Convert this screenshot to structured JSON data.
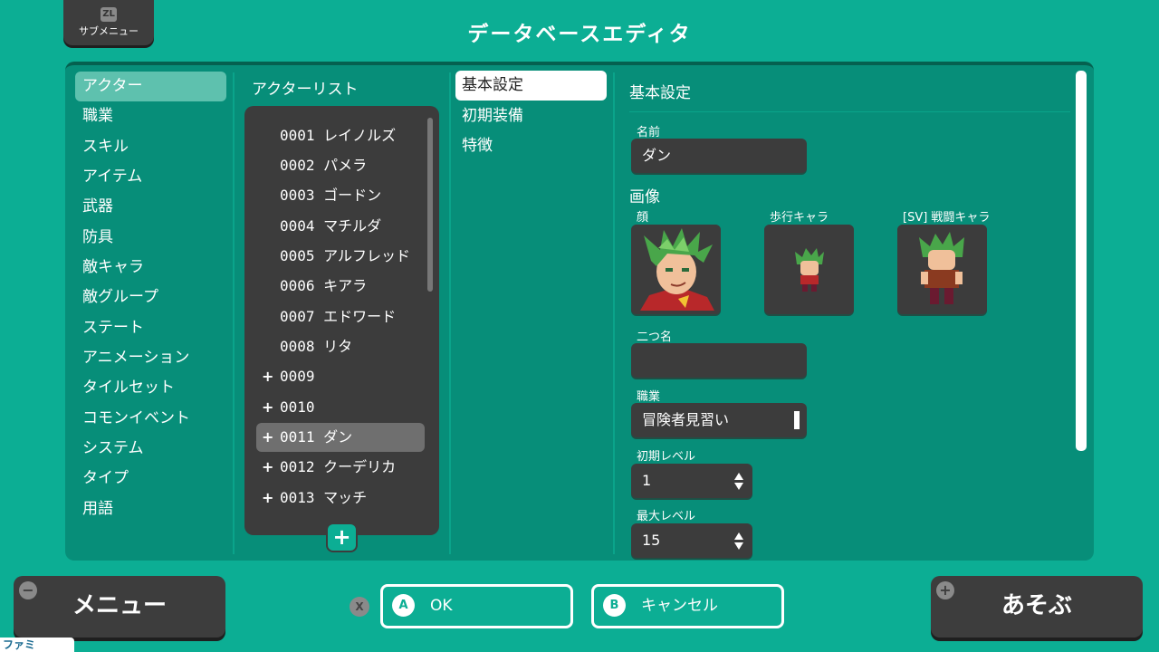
{
  "header": {
    "zl_key": "ZL",
    "zl_label": "サブメニュー",
    "title": "データベースエディタ"
  },
  "categories": [
    {
      "label": "アクター",
      "selected": true
    },
    {
      "label": "職業"
    },
    {
      "label": "スキル"
    },
    {
      "label": "アイテム"
    },
    {
      "label": "武器"
    },
    {
      "label": "防具"
    },
    {
      "label": "敵キャラ"
    },
    {
      "label": "敵グループ"
    },
    {
      "label": "ステート"
    },
    {
      "label": "アニメーション"
    },
    {
      "label": "タイルセット"
    },
    {
      "label": "コモンイベント"
    },
    {
      "label": "システム"
    },
    {
      "label": "タイプ"
    },
    {
      "label": "用語"
    }
  ],
  "actor_list": {
    "header": "アクターリスト",
    "add_symbol": "+",
    "items": [
      {
        "label": "0001 レイノルズ",
        "plus": ""
      },
      {
        "label": "0002 パメラ",
        "plus": ""
      },
      {
        "label": "0003 ゴードン",
        "plus": ""
      },
      {
        "label": "0004 マチルダ",
        "plus": ""
      },
      {
        "label": "0005 アルフレッド",
        "plus": ""
      },
      {
        "label": "0006 キアラ",
        "plus": ""
      },
      {
        "label": "0007 エドワード",
        "plus": ""
      },
      {
        "label": "0008 リタ",
        "plus": ""
      },
      {
        "label": "0009",
        "plus": "+"
      },
      {
        "label": "0010",
        "plus": "+"
      },
      {
        "label": "0011 ダン",
        "plus": "+",
        "selected": true
      },
      {
        "label": "0012 クーデリカ",
        "plus": "+"
      },
      {
        "label": "0013 マッチ",
        "plus": "+"
      }
    ]
  },
  "tabs": [
    {
      "label": "基本設定",
      "selected": true
    },
    {
      "label": "初期装備"
    },
    {
      "label": "特徴"
    }
  ],
  "detail": {
    "section_title": "基本設定",
    "name_label": "名前",
    "name_value": "ダン",
    "image_title": "画像",
    "face_label": "顔",
    "walk_label": "歩行キャラ",
    "battle_label": "[SV] 戦闘キャラ",
    "nickname_label": "二つ名",
    "nickname_value": "",
    "class_label": "職業",
    "class_value": "冒険者見習い",
    "init_level_label": "初期レベル",
    "init_level_value": "1",
    "max_level_label": "最大レベル",
    "max_level_value": "15"
  },
  "footer": {
    "menu_icon": "−",
    "menu_label": "メニュー",
    "x_key": "X",
    "ok_key": "A",
    "ok_label": "OK",
    "cancel_key": "B",
    "cancel_label": "キャンセル",
    "play_icon": "+",
    "play_label": "あそぶ",
    "watermark": "ファミ通.com"
  },
  "colors": {
    "background": "#0cae94",
    "panel": "#078e79",
    "dark": "#3c3c3c"
  }
}
